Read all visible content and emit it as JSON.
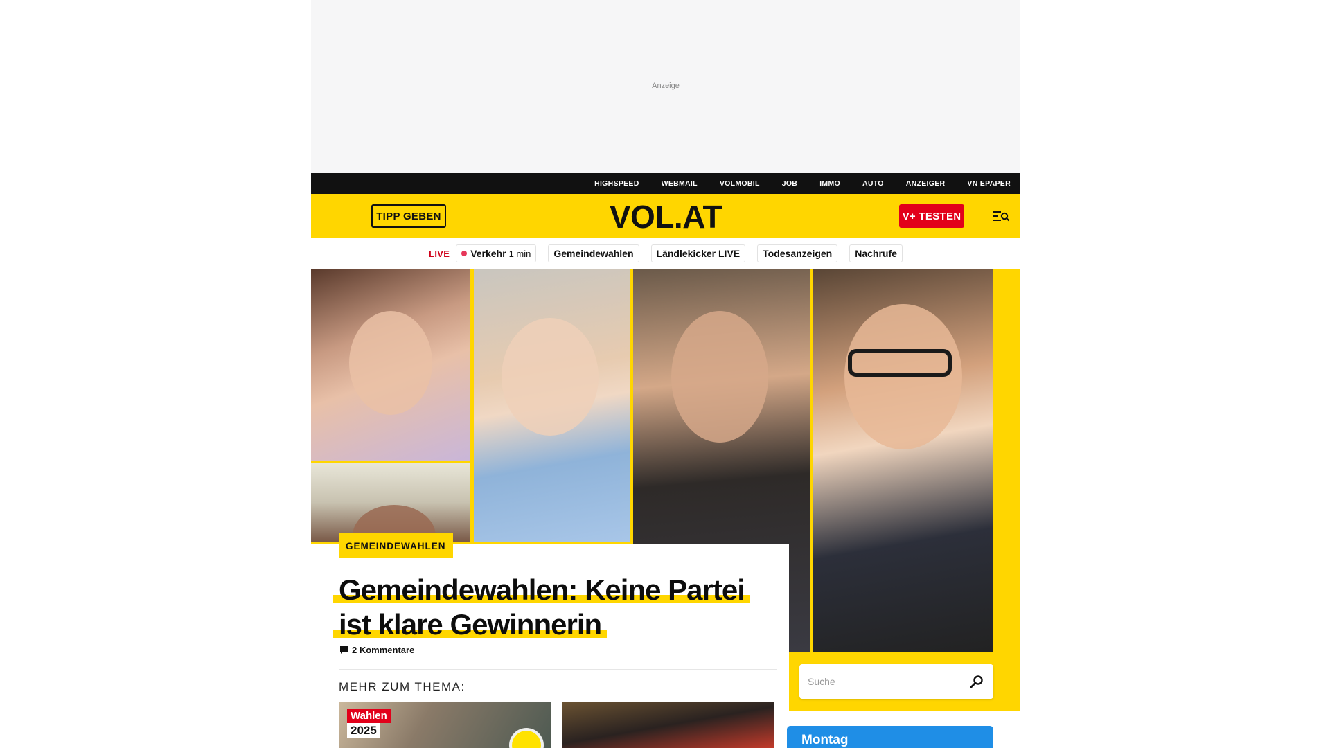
{
  "ad": {
    "label": "Anzeige"
  },
  "topbar": {
    "links": [
      "HIGHSPEED",
      "WEBMAIL",
      "VOLMOBIL",
      "JOB",
      "IMMO",
      "AUTO",
      "ANZEIGER",
      "VN EPAPER"
    ]
  },
  "header": {
    "tipp_label": "TIPP GEBEN",
    "logo": "VOL.AT",
    "vplus_label": "V+ TESTEN",
    "brand_color": "#ffd600",
    "accent_red": "#e2001a"
  },
  "quicknav": {
    "live_label": "LIVE",
    "traffic_label": "Verkehr",
    "traffic_time": "1 min",
    "chips": [
      "Gemeindewahlen",
      "Ländlekicker LIVE",
      "Todesanzeigen",
      "Nachrufe"
    ]
  },
  "hero": {
    "badge": "GEMEINDEWAHLEN",
    "headline": "Gemeindewahlen: Keine Partei ist klare Gewinnerin",
    "comments": "2 Kommentare",
    "more_label": "MEHR ZUM THEMA:"
  },
  "search": {
    "placeholder": "Suche"
  },
  "related": [
    {
      "tag_line1": "Wahlen",
      "tag_line2": "2025"
    },
    {}
  ],
  "weather": {
    "day": "Montag"
  }
}
